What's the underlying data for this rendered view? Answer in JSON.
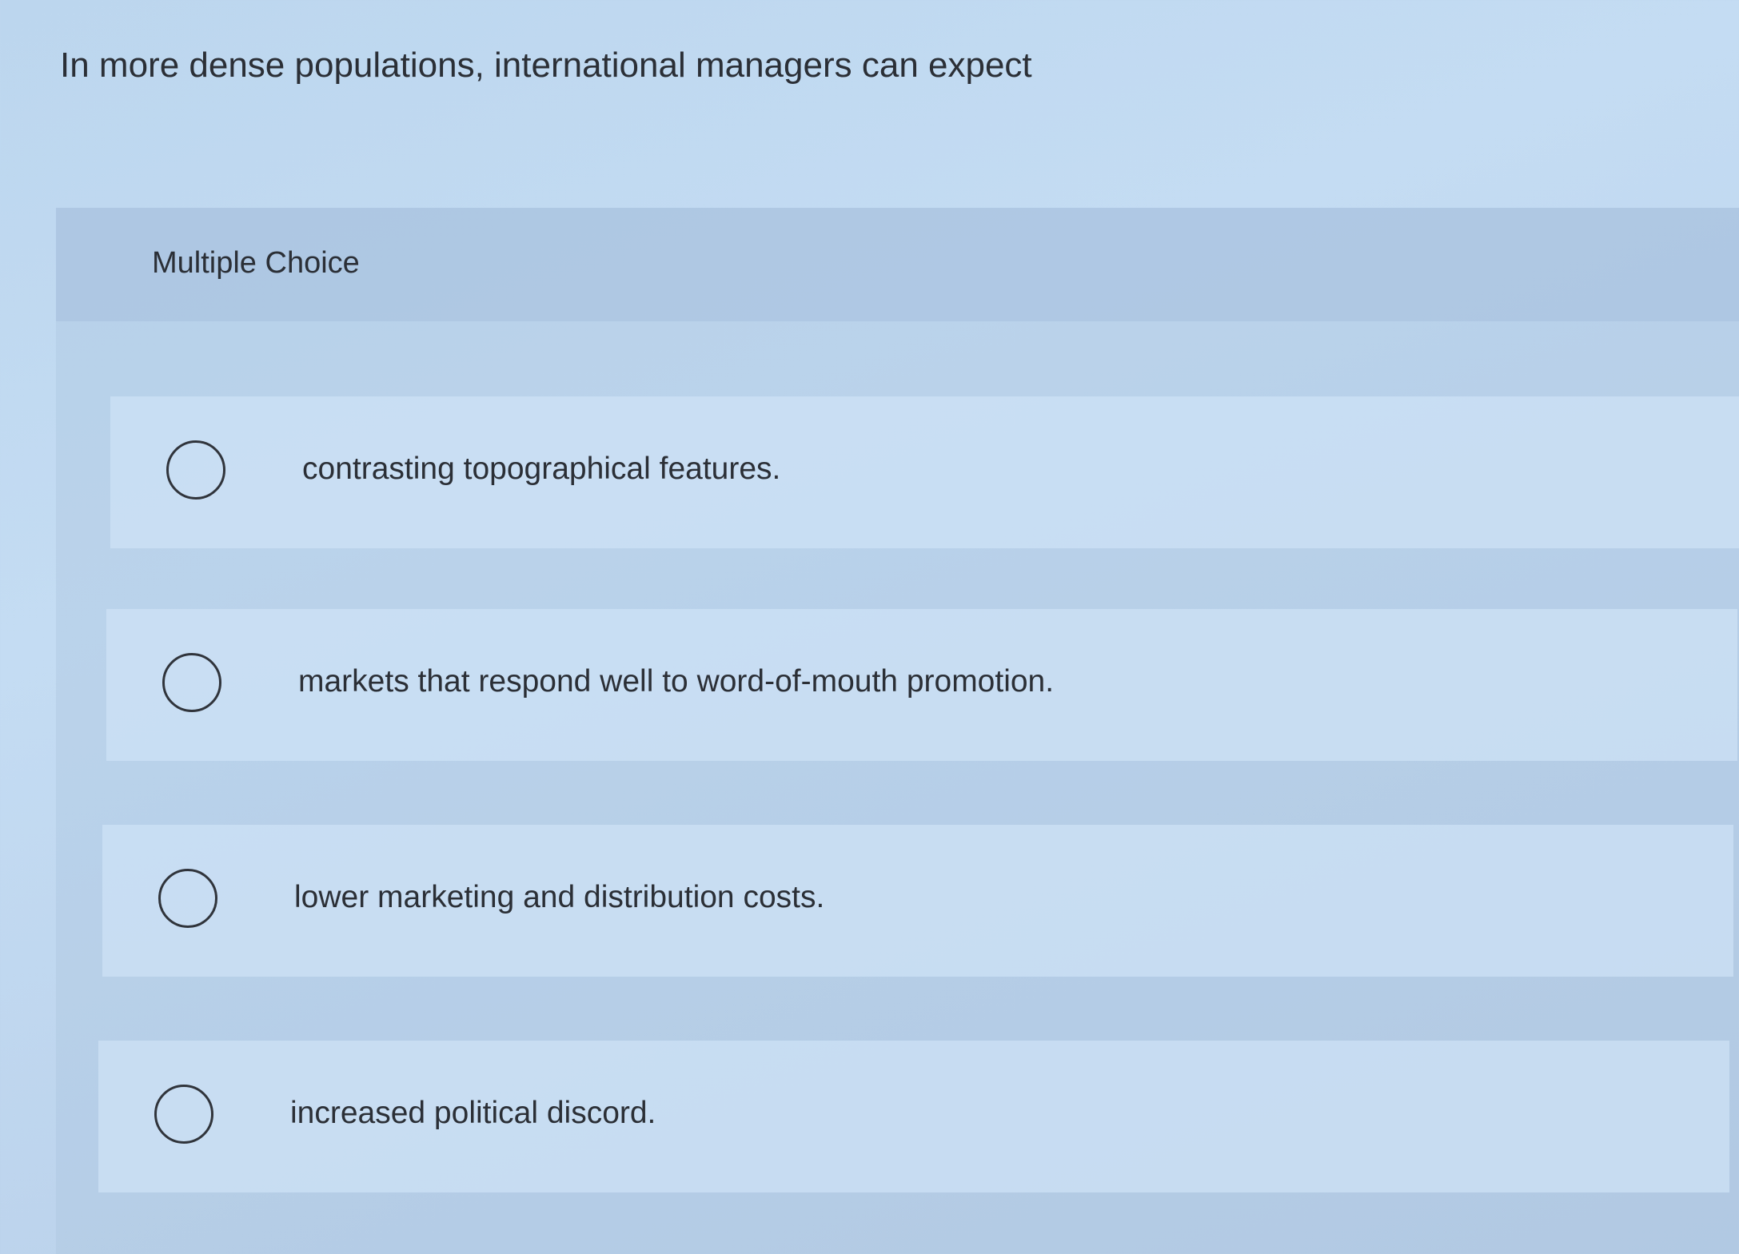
{
  "question": {
    "text": "In more dense populations, international managers can expect"
  },
  "card": {
    "header_label": "Multiple Choice",
    "options": [
      {
        "label": "contrasting topographical features.",
        "selected": false
      },
      {
        "label": "markets that respond well to word-of-mouth promotion.",
        "selected": false
      },
      {
        "label": "lower marketing and distribution costs.",
        "selected": false
      },
      {
        "label": "increased political discord.",
        "selected": false
      }
    ]
  }
}
